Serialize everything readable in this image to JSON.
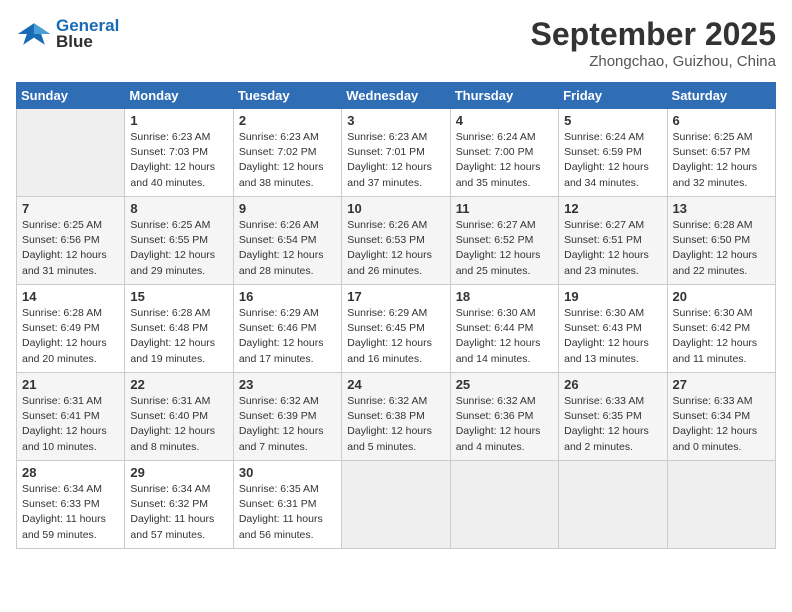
{
  "header": {
    "logo_line1": "General",
    "logo_line2": "Blue",
    "month": "September 2025",
    "location": "Zhongchao, Guizhou, China"
  },
  "days_of_week": [
    "Sunday",
    "Monday",
    "Tuesday",
    "Wednesday",
    "Thursday",
    "Friday",
    "Saturday"
  ],
  "weeks": [
    [
      {
        "day": "",
        "info": ""
      },
      {
        "day": "1",
        "info": "Sunrise: 6:23 AM\nSunset: 7:03 PM\nDaylight: 12 hours\nand 40 minutes."
      },
      {
        "day": "2",
        "info": "Sunrise: 6:23 AM\nSunset: 7:02 PM\nDaylight: 12 hours\nand 38 minutes."
      },
      {
        "day": "3",
        "info": "Sunrise: 6:23 AM\nSunset: 7:01 PM\nDaylight: 12 hours\nand 37 minutes."
      },
      {
        "day": "4",
        "info": "Sunrise: 6:24 AM\nSunset: 7:00 PM\nDaylight: 12 hours\nand 35 minutes."
      },
      {
        "day": "5",
        "info": "Sunrise: 6:24 AM\nSunset: 6:59 PM\nDaylight: 12 hours\nand 34 minutes."
      },
      {
        "day": "6",
        "info": "Sunrise: 6:25 AM\nSunset: 6:57 PM\nDaylight: 12 hours\nand 32 minutes."
      }
    ],
    [
      {
        "day": "7",
        "info": "Sunrise: 6:25 AM\nSunset: 6:56 PM\nDaylight: 12 hours\nand 31 minutes."
      },
      {
        "day": "8",
        "info": "Sunrise: 6:25 AM\nSunset: 6:55 PM\nDaylight: 12 hours\nand 29 minutes."
      },
      {
        "day": "9",
        "info": "Sunrise: 6:26 AM\nSunset: 6:54 PM\nDaylight: 12 hours\nand 28 minutes."
      },
      {
        "day": "10",
        "info": "Sunrise: 6:26 AM\nSunset: 6:53 PM\nDaylight: 12 hours\nand 26 minutes."
      },
      {
        "day": "11",
        "info": "Sunrise: 6:27 AM\nSunset: 6:52 PM\nDaylight: 12 hours\nand 25 minutes."
      },
      {
        "day": "12",
        "info": "Sunrise: 6:27 AM\nSunset: 6:51 PM\nDaylight: 12 hours\nand 23 minutes."
      },
      {
        "day": "13",
        "info": "Sunrise: 6:28 AM\nSunset: 6:50 PM\nDaylight: 12 hours\nand 22 minutes."
      }
    ],
    [
      {
        "day": "14",
        "info": "Sunrise: 6:28 AM\nSunset: 6:49 PM\nDaylight: 12 hours\nand 20 minutes."
      },
      {
        "day": "15",
        "info": "Sunrise: 6:28 AM\nSunset: 6:48 PM\nDaylight: 12 hours\nand 19 minutes."
      },
      {
        "day": "16",
        "info": "Sunrise: 6:29 AM\nSunset: 6:46 PM\nDaylight: 12 hours\nand 17 minutes."
      },
      {
        "day": "17",
        "info": "Sunrise: 6:29 AM\nSunset: 6:45 PM\nDaylight: 12 hours\nand 16 minutes."
      },
      {
        "day": "18",
        "info": "Sunrise: 6:30 AM\nSunset: 6:44 PM\nDaylight: 12 hours\nand 14 minutes."
      },
      {
        "day": "19",
        "info": "Sunrise: 6:30 AM\nSunset: 6:43 PM\nDaylight: 12 hours\nand 13 minutes."
      },
      {
        "day": "20",
        "info": "Sunrise: 6:30 AM\nSunset: 6:42 PM\nDaylight: 12 hours\nand 11 minutes."
      }
    ],
    [
      {
        "day": "21",
        "info": "Sunrise: 6:31 AM\nSunset: 6:41 PM\nDaylight: 12 hours\nand 10 minutes."
      },
      {
        "day": "22",
        "info": "Sunrise: 6:31 AM\nSunset: 6:40 PM\nDaylight: 12 hours\nand 8 minutes."
      },
      {
        "day": "23",
        "info": "Sunrise: 6:32 AM\nSunset: 6:39 PM\nDaylight: 12 hours\nand 7 minutes."
      },
      {
        "day": "24",
        "info": "Sunrise: 6:32 AM\nSunset: 6:38 PM\nDaylight: 12 hours\nand 5 minutes."
      },
      {
        "day": "25",
        "info": "Sunrise: 6:32 AM\nSunset: 6:36 PM\nDaylight: 12 hours\nand 4 minutes."
      },
      {
        "day": "26",
        "info": "Sunrise: 6:33 AM\nSunset: 6:35 PM\nDaylight: 12 hours\nand 2 minutes."
      },
      {
        "day": "27",
        "info": "Sunrise: 6:33 AM\nSunset: 6:34 PM\nDaylight: 12 hours\nand 0 minutes."
      }
    ],
    [
      {
        "day": "28",
        "info": "Sunrise: 6:34 AM\nSunset: 6:33 PM\nDaylight: 11 hours\nand 59 minutes."
      },
      {
        "day": "29",
        "info": "Sunrise: 6:34 AM\nSunset: 6:32 PM\nDaylight: 11 hours\nand 57 minutes."
      },
      {
        "day": "30",
        "info": "Sunrise: 6:35 AM\nSunset: 6:31 PM\nDaylight: 11 hours\nand 56 minutes."
      },
      {
        "day": "",
        "info": ""
      },
      {
        "day": "",
        "info": ""
      },
      {
        "day": "",
        "info": ""
      },
      {
        "day": "",
        "info": ""
      }
    ]
  ]
}
